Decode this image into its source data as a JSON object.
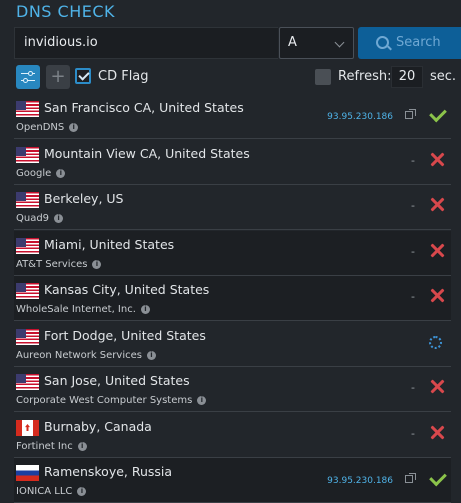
{
  "header": {
    "title": "DNS CHECK"
  },
  "search": {
    "domain_value": "invidious.io",
    "record_type": "A",
    "button_label": "Search"
  },
  "options": {
    "cd_flag_label": "CD Flag",
    "cd_flag_checked": true,
    "refresh_label": "Refresh:",
    "refresh_checked": false,
    "refresh_seconds": "20",
    "seconds_label": "sec."
  },
  "colors": {
    "accent": "#4fb3e8",
    "button": "#0d5f98",
    "error": "#d8484c",
    "success": "#8bc34a"
  },
  "results": [
    {
      "flag": "us",
      "location": "San Francisco CA, United States",
      "provider": "OpenDNS",
      "ip": "93.95.230.186",
      "status": "ok"
    },
    {
      "flag": "us",
      "location": "Mountain View CA, United States",
      "provider": "Google",
      "ip": "-",
      "status": "fail"
    },
    {
      "flag": "us",
      "location": "Berkeley, US",
      "provider": "Quad9",
      "ip": "-",
      "status": "fail"
    },
    {
      "flag": "us",
      "location": "Miami, United States",
      "provider": "AT&T Services",
      "ip": "-",
      "status": "fail"
    },
    {
      "flag": "us",
      "location": "Kansas City, United States",
      "provider": "WholeSale Internet, Inc.",
      "ip": "-",
      "status": "fail"
    },
    {
      "flag": "us",
      "location": "Fort Dodge, United States",
      "provider": "Aureon Network Services",
      "ip": "",
      "status": "loading"
    },
    {
      "flag": "us",
      "location": "San Jose, United States",
      "provider": "Corporate West Computer Systems",
      "ip": "-",
      "status": "fail"
    },
    {
      "flag": "ca",
      "location": "Burnaby, Canada",
      "provider": "Fortinet Inc",
      "ip": "-",
      "status": "fail"
    },
    {
      "flag": "ru",
      "location": "Ramenskoye, Russia",
      "provider": "IONICA LLC",
      "ip": "93.95.230.186",
      "status": "ok"
    }
  ]
}
